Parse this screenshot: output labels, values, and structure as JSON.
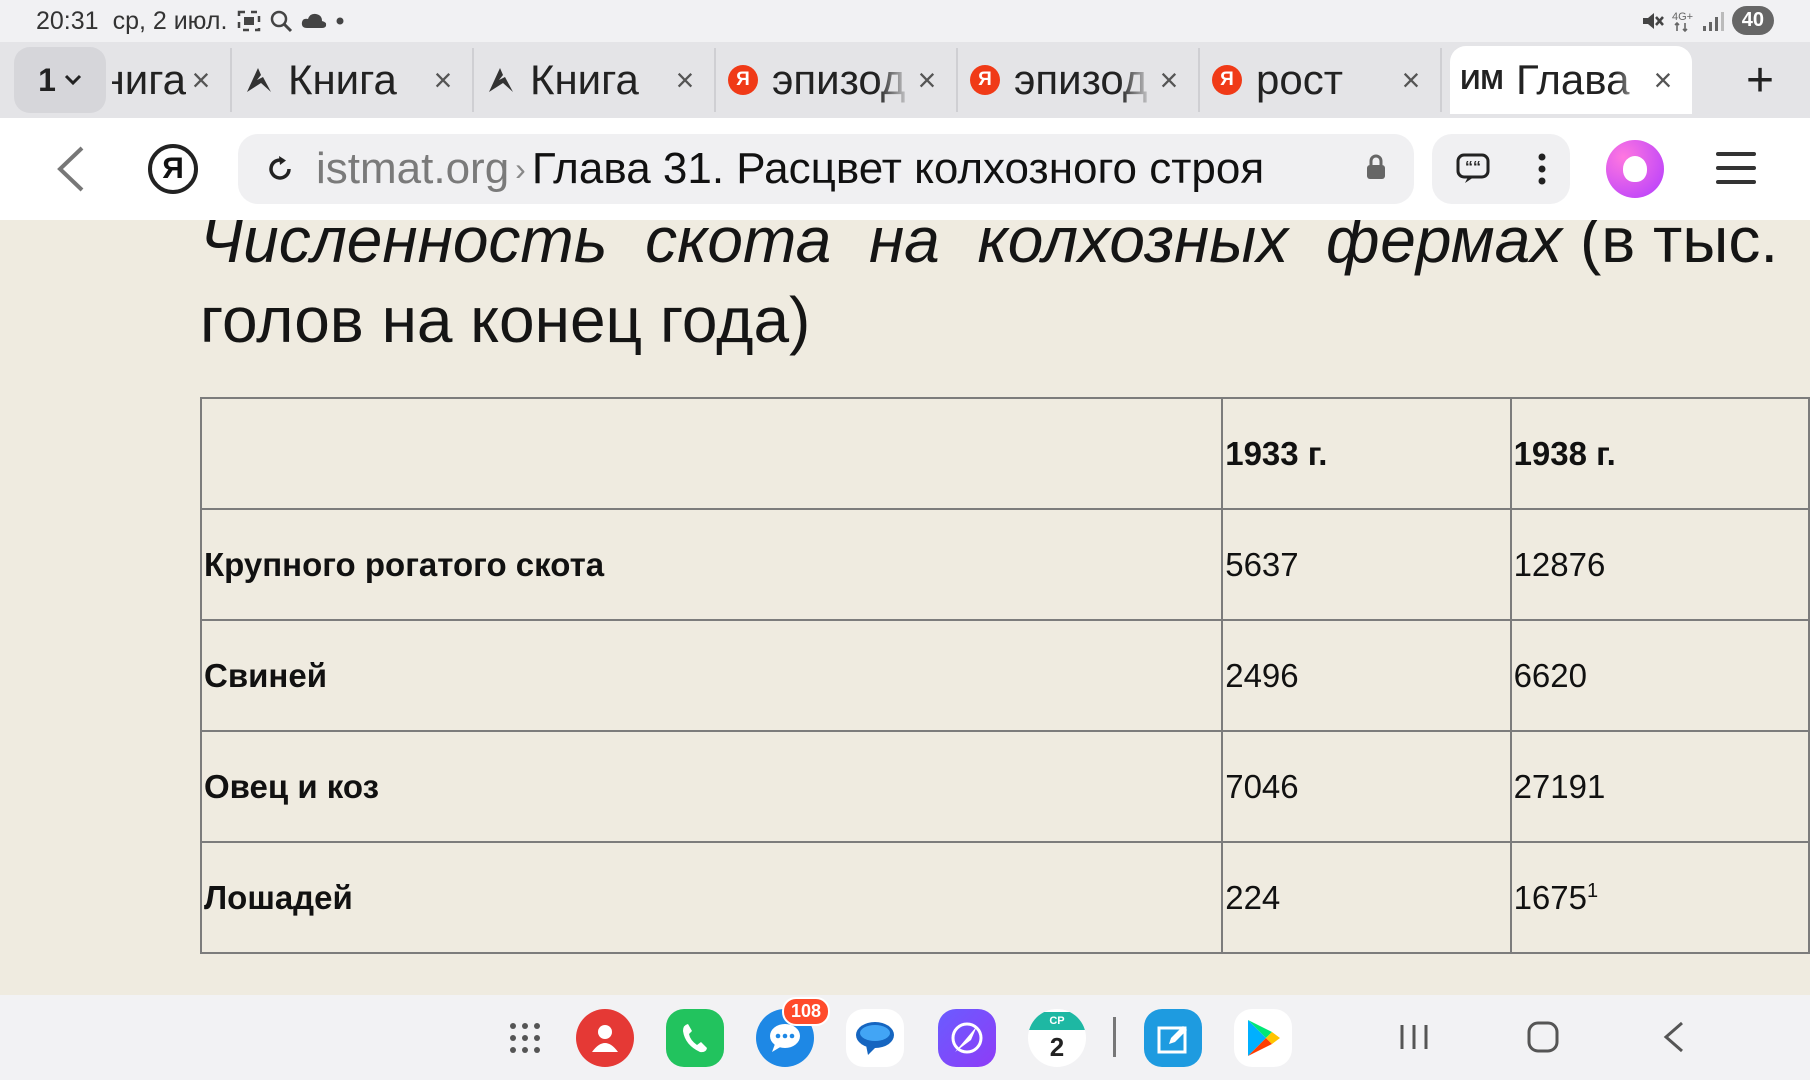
{
  "status_bar": {
    "time": "20:31",
    "date": "ср, 2 июл.",
    "left_icons": [
      "screenshot-icon",
      "search-icon",
      "cloud-icon",
      "dot-icon"
    ],
    "right_icons": [
      "mute-icon",
      "4g-icon",
      "signal-icon"
    ],
    "battery": "40"
  },
  "tabs": {
    "count": "1",
    "items": [
      {
        "title": "Книга",
        "icon": "none"
      },
      {
        "title": "Книга",
        "icon": "bookmark-pen-icon"
      },
      {
        "title": "Книга",
        "icon": "bookmark-pen-icon"
      },
      {
        "title": "эпизод",
        "icon": "yandex-icon"
      },
      {
        "title": "эпизод",
        "icon": "yandex-icon"
      },
      {
        "title": "рост",
        "icon": "yandex-icon"
      },
      {
        "title": "Глава",
        "icon": "im-icon",
        "favicon_text": "ИМ",
        "active": true
      }
    ],
    "close_glyph": "×",
    "new_tab_glyph": "+"
  },
  "toolbar": {
    "yandex_glyph": "Я",
    "domain": "istmat.org",
    "separator": "›",
    "page_title": "Глава 31. Расцвет колхозного строя"
  },
  "page": {
    "heading_italic": "Численность скота на колхозных фермах",
    "heading_rest": " (в тыс.",
    "heading_line2": "голов на конец года)",
    "table": {
      "columns": [
        "",
        "1933 г.",
        "1938 г."
      ],
      "rows": [
        {
          "label": "Крупного рогатого скота",
          "y1933": "5637",
          "y1938": "12876",
          "note": ""
        },
        {
          "label": "Свиней",
          "y1933": "2496",
          "y1938": "6620",
          "note": ""
        },
        {
          "label": "Овец и коз",
          "y1933": "7046",
          "y1938": "27191",
          "note": ""
        },
        {
          "label": "Лошадей",
          "y1933": "224",
          "y1938": "1675",
          "note": "1"
        }
      ]
    }
  },
  "dock": {
    "apps": [
      "apps-grid-icon",
      "contacts-icon",
      "phone-icon",
      "messages-icon",
      "chat-icon",
      "browser-icon",
      "calendar-icon",
      "screenshot-edit-icon",
      "play-store-icon"
    ],
    "messages_badge": "108",
    "calendar_day": "2",
    "calendar_weekday": "СР"
  },
  "colors": {
    "page_bg": "#efebe0",
    "border": "#7c7c7c",
    "yandex_red": "#f03a17"
  }
}
